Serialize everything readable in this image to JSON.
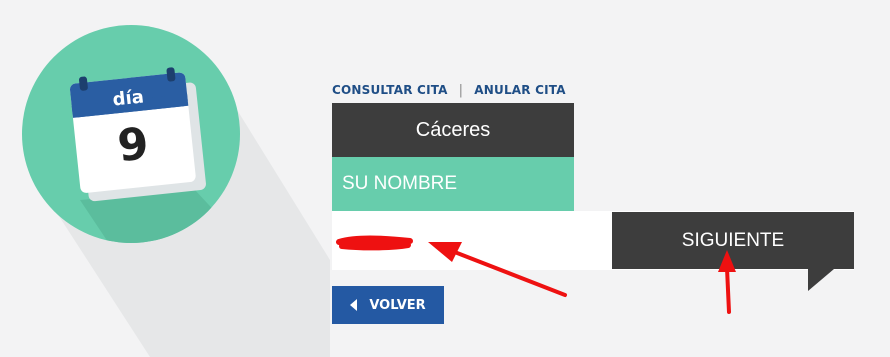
{
  "logo": {
    "day_label": "día",
    "day_number": "9"
  },
  "nav": {
    "consultar": "CONSULTAR CITA",
    "separator": "|",
    "anular": "ANULAR CITA"
  },
  "form": {
    "city": "Cáceres",
    "name_label": "SU NOMBRE",
    "name_value_redacted": true,
    "next_button": "SIGUIENTE",
    "back_button": "VOLVER"
  },
  "colors": {
    "circle": "#67cdac",
    "dark_panel": "#3d3d3d",
    "green_panel": "#67cdac",
    "link_blue": "#1f4e86",
    "button_blue": "#2459a3",
    "annotation_red": "#ee1111"
  },
  "annotations": [
    "red-arrow-to-name-field",
    "red-arrow-to-next-button"
  ]
}
